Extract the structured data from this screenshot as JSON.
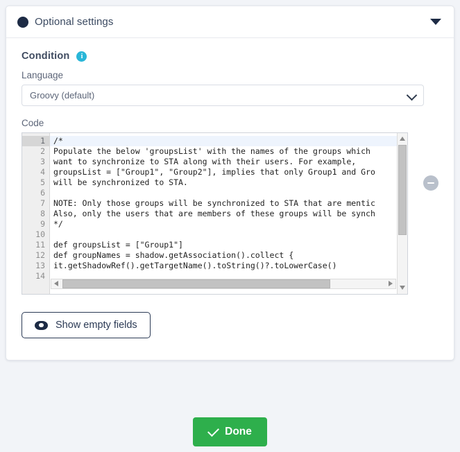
{
  "card": {
    "header": {
      "title": "Optional settings",
      "dot_icon": "filled-circle-icon",
      "collapse_icon": "chevron-down-icon"
    },
    "condition": {
      "title": "Condition",
      "info_icon": "info-icon",
      "info_glyph": "i",
      "language_label": "Language",
      "language_value": "Groovy (default)",
      "language_options": [
        "Groovy (default)"
      ],
      "code_label": "Code",
      "remove_icon": "minus-circle-icon"
    },
    "code": {
      "lines": [
        {
          "n": "1",
          "text": "/*"
        },
        {
          "n": "2",
          "text": "Populate the below 'groupsList' with the names of the groups which"
        },
        {
          "n": "3",
          "text": "want to synchronize to STA along with their users. For example,"
        },
        {
          "n": "4",
          "text": "groupsList = [\"Group1\", \"Group2\"], implies that only Group1 and Gro"
        },
        {
          "n": "5",
          "text": "will be synchronized to STA."
        },
        {
          "n": "6",
          "text": ""
        },
        {
          "n": "7",
          "text": "NOTE: Only those groups will be synchronized to STA that are mentic"
        },
        {
          "n": "8",
          "text": "Also, only the users that are members of these groups will be synch"
        },
        {
          "n": "9",
          "text": "*/"
        },
        {
          "n": "10",
          "text": ""
        },
        {
          "n": "11",
          "text": "def groupsList = [\"Group1\"]"
        },
        {
          "n": "12",
          "text": "def groupNames = shadow.getAssociation().collect {"
        },
        {
          "n": "13",
          "text": "it.getShadowRef().getTargetName().toString()?.toLowerCase()"
        },
        {
          "n": "14",
          "text": ""
        }
      ],
      "active_line": 1
    },
    "show_empty_fields": {
      "label": "Show empty fields",
      "icon": "eye-icon"
    }
  },
  "footer": {
    "done_label": "Done",
    "done_icon": "check-icon"
  },
  "colors": {
    "accent_green": "#2eaf4c",
    "info_teal": "#29b6d8",
    "dark_navy": "#1d2b45",
    "page_bg": "#f2f4f8"
  }
}
